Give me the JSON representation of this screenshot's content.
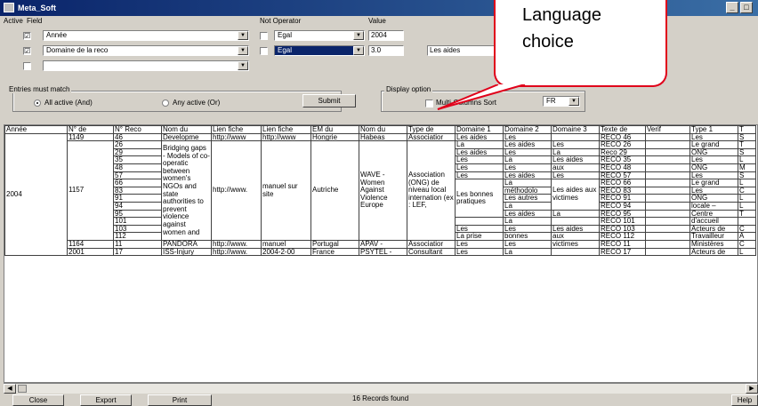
{
  "window": {
    "title": "Meta_Soft",
    "min": "_",
    "max": "□"
  },
  "filter": {
    "headers": {
      "active": "Active",
      "field": "Field",
      "not_operator": "Not Operator",
      "value": "Value"
    },
    "rows": [
      {
        "checked": "☑",
        "field": "Année",
        "not_checked": "☐",
        "operator": "Egal",
        "value": "2004",
        "operator_selected": false
      },
      {
        "checked": "☑",
        "field": "Domaine de la reco",
        "not_checked": "☐",
        "operator": "Egal",
        "value": "3.0",
        "operator_selected": true
      },
      {
        "checked": "☐",
        "field": "",
        "not_checked": "",
        "operator": "",
        "value": "",
        "operator_selected": false
      }
    ],
    "value2_extra": "Les aides"
  },
  "match": {
    "group_label": "Entries must match",
    "all_active": "All active (And)",
    "any_active": "Any active (Or)",
    "submit": "Submit"
  },
  "display": {
    "group_label": "Display option",
    "multi_columns": "Multi-Columns Sort",
    "language": "FR"
  },
  "callout": {
    "line1": "Language",
    "line2": "choice"
  },
  "grid": {
    "columns": [
      "Année",
      "N° de",
      "N° Reco",
      "Nom du",
      "Lien fiche",
      "Lien fiche",
      "EM du",
      "Nom du",
      "Type de",
      "Domaine 1",
      "Domaine 2",
      "Domaine 3",
      "Texte de",
      "Verif",
      "Type 1",
      "T"
    ],
    "row_1149": {
      "num": "1149",
      "reco": "46",
      "nom": "Developme",
      "lien1": "http://www",
      "lien2": "http://www",
      "em": "Hongrie",
      "nom2": "Habeas",
      "type": "Associatior",
      "d1": "Les aides",
      "d2": "Les",
      "d3": "",
      "texte": "RECO 46",
      "type1": "Les",
      "t": "S"
    },
    "group_2004": {
      "annee": "2004",
      "num": "1157",
      "nom_text": "Bridging gaps - Models of co-operatic between women's NGOs and state authorities to prevent violence against women and",
      "lien1": "http://www.",
      "lien2": "manuel sur site",
      "em": "Autriche",
      "nom2": "WAVE - Women Against Violence Europe",
      "type": "Association (ONG) de niveau local internation (ex : LEF,",
      "d1_mid": "Les bonnes pratiques",
      "d3_mid": "Les aides aux victimes",
      "rows": [
        {
          "reco": "26",
          "d1": "La",
          "d2": "Les aides",
          "d3": "Les",
          "texte": "RECO 26",
          "type1": "Le grand",
          "t": "T"
        },
        {
          "reco": "29",
          "d1": "Les aides",
          "d2": "Les",
          "d3": "La",
          "texte": "Reco 29",
          "type1": "ONG",
          "t": "S"
        },
        {
          "reco": "35",
          "d1": "Les",
          "d2": "La",
          "d3": "Les aides",
          "texte": "RECO 35",
          "type1": "Les",
          "t": "L"
        },
        {
          "reco": "48",
          "d1": "Les",
          "d2": "Les",
          "d3": "aux",
          "texte": "RECO 48",
          "type1": "ONG",
          "t": "M"
        },
        {
          "reco": "57",
          "d1": "Les",
          "d2": "Les aides",
          "d3": "Les",
          "texte": "RECO 57",
          "type1": "Les",
          "t": "S"
        },
        {
          "reco": "66",
          "d1": "",
          "d2": "La",
          "d3": "",
          "texte": "RECO 66",
          "type1": "Le grand",
          "t": "L"
        },
        {
          "reco": "83",
          "d1": "",
          "d2": "méthodolo",
          "d3": "",
          "texte": "RECO 83",
          "type1": "Les",
          "t": "C"
        },
        {
          "reco": "91",
          "d1": "",
          "d2": "Les autres",
          "d3": "",
          "texte": "RECO 91",
          "type1": "ONG",
          "t": "L"
        },
        {
          "reco": "94",
          "d1": "",
          "d2": "La",
          "d3": "",
          "texte": "RECO 94",
          "type1": "locale –",
          "t": "L"
        },
        {
          "reco": "95",
          "d1": "",
          "d2": "Les aides",
          "d3": "La",
          "texte": "RECO 95",
          "type1": "Centre",
          "t": "T"
        },
        {
          "reco": "101",
          "d1": "",
          "d2": "La",
          "d3": "",
          "texte": "RECO 101",
          "type1": "d'accueil",
          "t": ""
        },
        {
          "reco": "103",
          "d1": "Les",
          "d2": "Les",
          "d3": "Les aides",
          "texte": "RECO 103",
          "type1": "Acteurs de",
          "t": "C"
        },
        {
          "reco": "112",
          "d1": "La prise",
          "d2": "bonnes",
          "d3": "aux",
          "texte": "RECO 112",
          "type1": "Travailleur",
          "t": "A"
        }
      ]
    },
    "row_1164": {
      "num": "1164",
      "reco": "11",
      "nom": "PANDORA",
      "lien1": "http://www.",
      "lien2": "manuel",
      "em": "Portugal",
      "nom2": "APAV -",
      "type": "Associatior",
      "d1": "Les",
      "d2": "Les",
      "d3": "victimes",
      "texte": "RECO 11",
      "type1": "Ministères",
      "t": "C"
    },
    "row_2001": {
      "num": "2001",
      "reco": "17",
      "nom": "ISS-Injury",
      "lien1": "http://www.",
      "lien2": "2004-2-00",
      "em": "France",
      "nom2": "PSYTEL -",
      "type": "Consultant",
      "d1": "Les",
      "d2": "La",
      "d3": "",
      "texte": "RECO 17",
      "type1": "Acteurs de",
      "t": "L"
    }
  },
  "status": {
    "records": "16 Records found"
  },
  "buttons": {
    "close": "Close",
    "export": "Export",
    "print": "Print",
    "help": "Help"
  }
}
